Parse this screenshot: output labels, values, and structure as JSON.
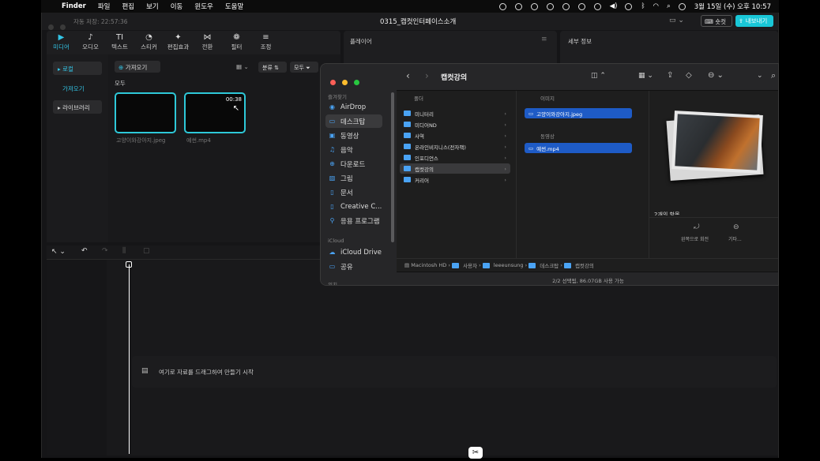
{
  "menubar": {
    "app": "Finder",
    "items": [
      "파일",
      "편집",
      "보기",
      "이동",
      "윈도우",
      "도움말"
    ],
    "datetime": "3월 15일 (수) 오후 10:57"
  },
  "app": {
    "autosave": "자동 저장: 22:57:36",
    "project_title": "0315_캡컷인터페이스소개",
    "shortcut_label": "숏컷",
    "export_label": "내보내기",
    "tools": [
      {
        "label": "미디어",
        "icon": "▶"
      },
      {
        "label": "오디오",
        "icon": "♪"
      },
      {
        "label": "텍스트",
        "icon": "TI"
      },
      {
        "label": "스티커",
        "icon": "◔"
      },
      {
        "label": "편집효과",
        "icon": "✦"
      },
      {
        "label": "전환",
        "icon": "⋈"
      },
      {
        "label": "필터",
        "icon": "❁"
      },
      {
        "label": "조정",
        "icon": "≡"
      }
    ],
    "side_nav": [
      "로컬",
      "가져오기",
      "라이브러리"
    ],
    "import_button": "가져오기",
    "sort_label": "분류",
    "all_label": "모두",
    "section_all": "모두",
    "media": [
      {
        "name": "고양이와강아지.jpeg",
        "duration": ""
      },
      {
        "name": "예썬.mp4",
        "duration": "00:38"
      }
    ],
    "player_label": "플레이어",
    "details_label": "세부 정보",
    "timeline_hint": "여기로 자료를 드래그하여 만들기 시작"
  },
  "finder": {
    "title": "캡컷강의",
    "sidebar_section_favorites": "즐겨찾기",
    "sidebar": [
      "AirDrop",
      "데스크탑",
      "동영상",
      "음악",
      "다운로드",
      "그림",
      "문서",
      "Creative C...",
      "응용 프로그램"
    ],
    "sidebar_section_icloud": "iCloud",
    "icloud": [
      "iCloud Drive",
      "공유"
    ],
    "sidebar_section_tags": "위치",
    "col1_header": "폴더",
    "folders": [
      "미니터리",
      "미디어ND",
      "사역",
      "온라인비지니스(전자책)",
      "인포디언스",
      "캡컷강의",
      "커리어"
    ],
    "col2_header_image": "이미지",
    "image_file": "고양이와강아지.jpeg",
    "col2_header_video": "동영상",
    "video_file": "예썬.mp4",
    "preview_caption": "2개의 항목",
    "preview_actions": [
      "왼쪽으로 회전",
      "기타..."
    ],
    "path": [
      "Macintosh HD",
      "사용자",
      "leeeunsung",
      "데스크탑",
      "캡컷강의"
    ],
    "status": "2/2 선택됨, 86.07GB 사용 가능"
  },
  "colors": {
    "accent": "#2ec8d8",
    "selection": "#1e5bc6",
    "folder": "#4aa3f4"
  }
}
